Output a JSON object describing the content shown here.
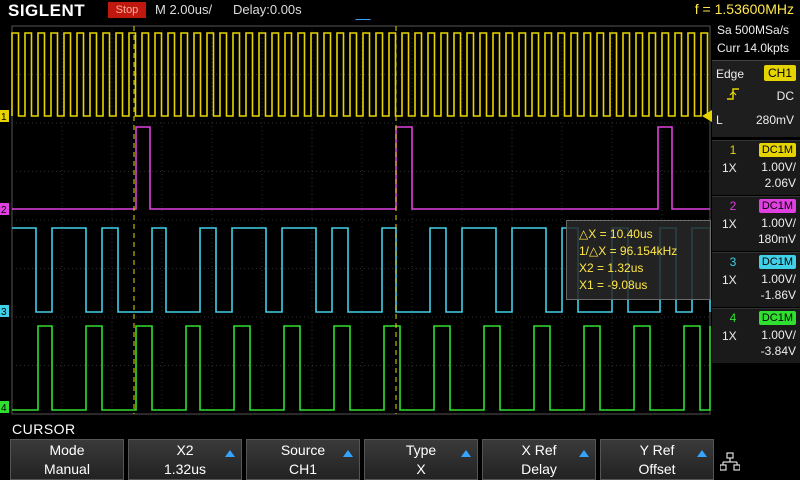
{
  "header": {
    "brand": "SIGLENT",
    "run_state": "Stop",
    "timebase": "M 2.00us/",
    "delay": "Delay:0.00s",
    "frequency": "f = 1.53600MHz"
  },
  "acquisition": {
    "sample_rate": "Sa 500MSa/s",
    "memory_depth": "Curr 14.0kpts"
  },
  "trigger": {
    "type": "Edge",
    "source": "CH1",
    "coupling": "DC",
    "level_label": "L",
    "level": "280mV"
  },
  "channels": [
    {
      "num": "1",
      "coupling": "DC1M",
      "probe": "1X",
      "scale": "1.00V/",
      "offset": "2.06V",
      "color": "#e6d400"
    },
    {
      "num": "2",
      "coupling": "DC1M",
      "probe": "1X",
      "scale": "1.00V/",
      "offset": "180mV",
      "color": "#e040e0"
    },
    {
      "num": "3",
      "coupling": "DC1M",
      "probe": "1X",
      "scale": "1.00V/",
      "offset": "-1.86V",
      "color": "#40d0e8"
    },
    {
      "num": "4",
      "coupling": "DC1M",
      "probe": "1X",
      "scale": "1.00V/",
      "offset": "-3.84V",
      "color": "#30e030"
    }
  ],
  "cursor_readout": {
    "delta_x": "△X = 10.40us",
    "inv_delta_x": "1/△X = 96.154kHz",
    "x2": "X2 = 1.32us",
    "x1": "X1 = -9.08us"
  },
  "menu": {
    "title": "CURSOR",
    "softkeys": [
      {
        "label": "Mode",
        "value": "Manual",
        "arrow": false
      },
      {
        "label": "X2",
        "value": "1.32us",
        "arrow": true
      },
      {
        "label": "Source",
        "value": "CH1",
        "arrow": true
      },
      {
        "label": "Type",
        "value": "X",
        "arrow": true
      },
      {
        "label": "X Ref",
        "value": "Delay",
        "arrow": true
      },
      {
        "label": "Y Ref",
        "value": "Offset",
        "arrow": true
      }
    ]
  },
  "waveform_markers": [
    "1",
    "2",
    "3",
    "4"
  ],
  "icons": {
    "network": "network-icon",
    "trigger_position": "trigger-position-icon",
    "slope": "rising-edge-icon"
  }
}
